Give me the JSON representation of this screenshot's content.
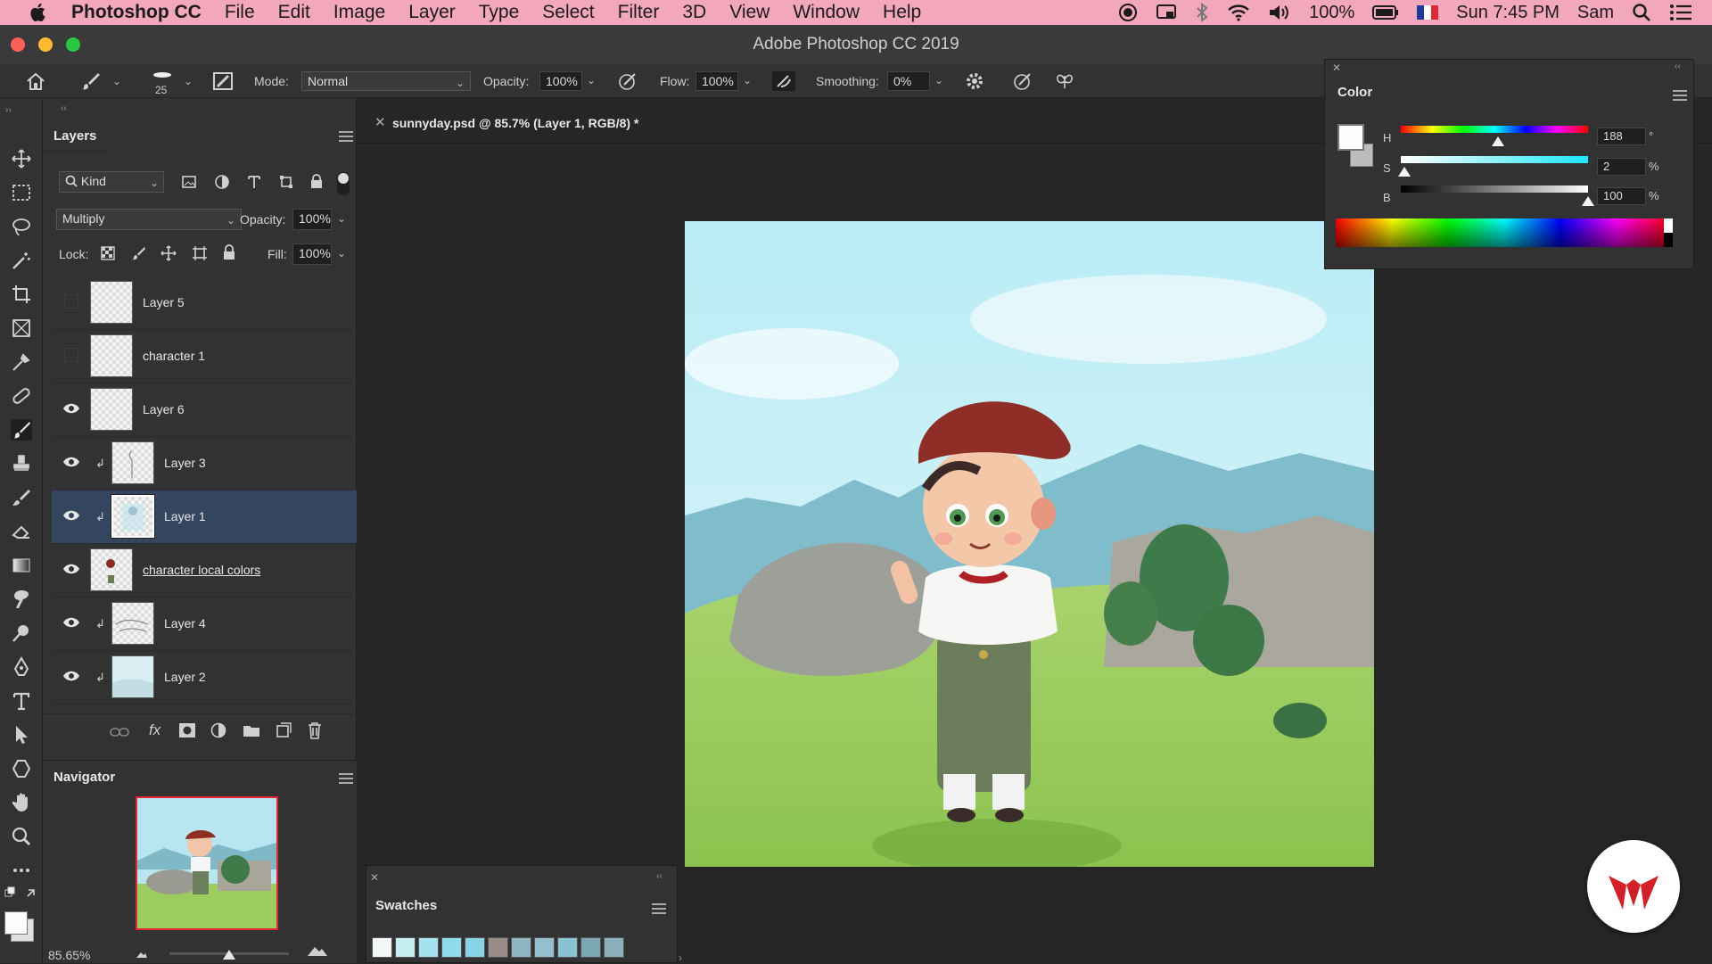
{
  "menubar": {
    "app": "Photoshop CC",
    "items": [
      "File",
      "Edit",
      "Image",
      "Layer",
      "Type",
      "Select",
      "Filter",
      "3D",
      "View",
      "Window",
      "Help"
    ],
    "battery": "100%",
    "clock": "Sun 7:45 PM",
    "user": "Sam"
  },
  "window": {
    "title": "Adobe Photoshop CC 2019"
  },
  "options": {
    "brush_size": "25",
    "mode_label": "Mode:",
    "mode_value": "Normal",
    "opacity_label": "Opacity:",
    "opacity_value": "100%",
    "flow_label": "Flow:",
    "flow_value": "100%",
    "smoothing_label": "Smoothing:",
    "smoothing_value": "0%"
  },
  "layers_panel": {
    "title": "Layers",
    "filter_kind": "Kind",
    "blend_mode": "Multiply",
    "opacity_label": "Opacity:",
    "opacity_value": "100%",
    "lock_label": "Lock:",
    "fill_label": "Fill:",
    "fill_value": "100%",
    "layers": [
      {
        "name": "Layer 5",
        "visible": false,
        "clipped": false,
        "selected": false
      },
      {
        "name": "character 1",
        "visible": false,
        "clipped": false,
        "selected": false
      },
      {
        "name": "Layer 6",
        "visible": true,
        "clipped": false,
        "selected": false
      },
      {
        "name": "Layer 3",
        "visible": true,
        "clipped": true,
        "selected": false
      },
      {
        "name": "Layer 1",
        "visible": true,
        "clipped": true,
        "selected": true
      },
      {
        "name": "character local colors",
        "visible": true,
        "clipped": false,
        "selected": false
      },
      {
        "name": "Layer 4",
        "visible": true,
        "clipped": true,
        "selected": false
      },
      {
        "name": "Layer 2",
        "visible": true,
        "clipped": true,
        "selected": false
      }
    ]
  },
  "navigator": {
    "title": "Navigator",
    "zoom": "85.65%"
  },
  "document": {
    "tab_title": "sunnyday.psd @ 85.7% (Layer 1, RGB/8) *"
  },
  "color_panel": {
    "title": "Color",
    "h_label": "H",
    "h_value": "188",
    "h_unit": "°",
    "s_label": "S",
    "s_value": "2",
    "s_unit": "%",
    "b_label": "B",
    "b_value": "100",
    "b_unit": "%",
    "h_fraction": 0.52,
    "s_fraction": 0.02,
    "b_fraction": 1.0
  },
  "swatches": {
    "title": "Swatches",
    "colors": [
      "#f2f6f7",
      "#c6eef2",
      "#a6e2ee",
      "#8fdced",
      "#87d4e9",
      "#9a8b86",
      "#8eb6c2",
      "#95bfcc",
      "#88c3d3",
      "#7ba6b4",
      "#8ab0bd"
    ]
  }
}
